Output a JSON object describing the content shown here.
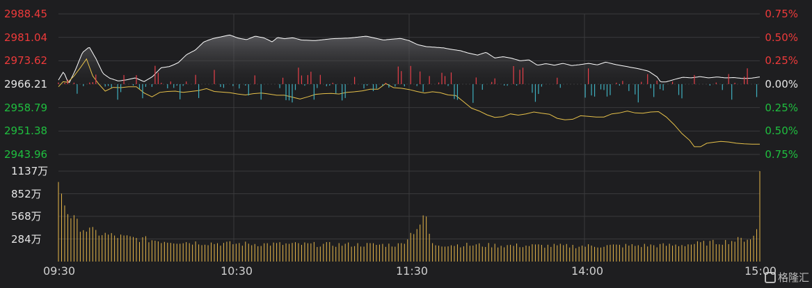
{
  "chart_data": {
    "type": "line",
    "subtype": "intraday-timeshare",
    "price_axis": {
      "ticks": [
        "2988.45",
        "2981.04",
        "2973.62",
        "2966.21",
        "2958.79",
        "2951.38",
        "2943.96"
      ],
      "ylim": [
        2943.96,
        2988.45
      ],
      "prev_close": 2966.21
    },
    "pct_axis": {
      "ticks": [
        "0.75%",
        "0.50%",
        "0.25%",
        "0.00%",
        "0.25%",
        "0.50%",
        "0.75%"
      ]
    },
    "volume_axis": {
      "ticks": [
        "1137万",
        "852万",
        "568万",
        "284万"
      ],
      "ylim": [
        0,
        1137
      ]
    },
    "time_labels": [
      "09:30",
      "10:30",
      "11:30",
      "14:00",
      "15:00"
    ],
    "colors": {
      "background": "#1e1e20",
      "up": "#e8404a",
      "down": "#3fb0c0",
      "price_line": "#ffffff",
      "avg_line": "#e8c24a",
      "volume": "#e8b84a",
      "grid": "#3a3a3c",
      "axis_up_text": "#ee3a3a",
      "axis_down_text": "#1fbf3f",
      "axis_neutral_text": "#e6e6e6"
    },
    "series": [
      {
        "name": "price",
        "points": [
          [
            0,
            2967.5
          ],
          [
            3,
            2970.2
          ],
          [
            6,
            2966.3
          ],
          [
            10,
            2970.8
          ],
          [
            14,
            2976.2
          ],
          [
            18,
            2978.0
          ],
          [
            22,
            2974.2
          ],
          [
            26,
            2969.6
          ],
          [
            30,
            2968.1
          ],
          [
            35,
            2967.2
          ],
          [
            40,
            2967.6
          ],
          [
            45,
            2968.2
          ],
          [
            50,
            2967.0
          ],
          [
            55,
            2968.6
          ],
          [
            60,
            2971.4
          ],
          [
            65,
            2971.8
          ],
          [
            70,
            2973.0
          ],
          [
            75,
            2975.6
          ],
          [
            80,
            2977.0
          ],
          [
            85,
            2979.6
          ],
          [
            90,
            2980.6
          ],
          [
            95,
            2981.2
          ],
          [
            100,
            2981.8
          ],
          [
            105,
            2980.8
          ],
          [
            110,
            2980.3
          ],
          [
            115,
            2981.4
          ],
          [
            120,
            2980.9
          ],
          [
            125,
            2979.6
          ],
          [
            128,
            2981.0
          ],
          [
            132,
            2980.6
          ],
          [
            137,
            2980.9
          ],
          [
            142,
            2980.2
          ],
          [
            150,
            2980.0
          ],
          [
            160,
            2980.6
          ],
          [
            170,
            2980.8
          ],
          [
            180,
            2981.4
          ],
          [
            190,
            2980.2
          ],
          [
            200,
            2980.7
          ],
          [
            205,
            2980.0
          ],
          [
            210,
            2978.7
          ],
          [
            215,
            2978.1
          ],
          [
            225,
            2977.7
          ],
          [
            230,
            2977.2
          ],
          [
            235,
            2976.8
          ],
          [
            240,
            2976.0
          ],
          [
            245,
            2975.4
          ],
          [
            250,
            2976.3
          ],
          [
            255,
            2974.5
          ],
          [
            260,
            2974.9
          ],
          [
            265,
            2974.4
          ],
          [
            270,
            2973.6
          ],
          [
            275,
            2973.9
          ],
          [
            280,
            2972.2
          ],
          [
            285,
            2972.7
          ],
          [
            290,
            2972.2
          ],
          [
            295,
            2972.8
          ],
          [
            300,
            2972.1
          ],
          [
            305,
            2972.4
          ],
          [
            310,
            2972.8
          ],
          [
            315,
            2972.3
          ],
          [
            320,
            2973.2
          ],
          [
            325,
            2972.5
          ],
          [
            330,
            2972.0
          ],
          [
            335,
            2971.5
          ],
          [
            340,
            2971.0
          ],
          [
            345,
            2970.3
          ],
          [
            350,
            2968.5
          ],
          [
            352,
            2966.9
          ],
          [
            355,
            2966.9
          ],
          [
            360,
            2967.7
          ],
          [
            365,
            2968.4
          ],
          [
            370,
            2968.2
          ],
          [
            375,
            2968.6
          ],
          [
            380,
            2968.2
          ],
          [
            385,
            2968.5
          ],
          [
            390,
            2968.2
          ],
          [
            395,
            2968.3
          ],
          [
            400,
            2968.0
          ],
          [
            405,
            2968.1
          ],
          [
            410,
            2968.5
          ]
        ]
      },
      {
        "name": "average",
        "points": [
          [
            0,
            2965.4
          ],
          [
            3,
            2967.0
          ],
          [
            6,
            2966.8
          ],
          [
            10,
            2968.8
          ],
          [
            14,
            2971.4
          ],
          [
            18,
            2974.2
          ],
          [
            22,
            2968.8
          ],
          [
            26,
            2966.2
          ],
          [
            30,
            2964.0
          ],
          [
            35,
            2965.2
          ],
          [
            40,
            2965.1
          ],
          [
            45,
            2965.4
          ],
          [
            50,
            2965.4
          ],
          [
            55,
            2963.4
          ],
          [
            60,
            2962.2
          ],
          [
            65,
            2963.6
          ],
          [
            70,
            2963.9
          ],
          [
            75,
            2964.0
          ],
          [
            80,
            2963.6
          ],
          [
            85,
            2963.9
          ],
          [
            90,
            2964.2
          ],
          [
            95,
            2964.8
          ],
          [
            100,
            2963.9
          ],
          [
            105,
            2963.7
          ],
          [
            110,
            2963.5
          ],
          [
            115,
            2963.1
          ],
          [
            120,
            2962.8
          ],
          [
            125,
            2963.2
          ],
          [
            130,
            2963.4
          ],
          [
            135,
            2963.1
          ],
          [
            140,
            2962.7
          ],
          [
            145,
            2962.7
          ],
          [
            150,
            2962.1
          ],
          [
            155,
            2961.5
          ],
          [
            160,
            2962.2
          ],
          [
            165,
            2963.0
          ],
          [
            170,
            2963.2
          ],
          [
            175,
            2963.3
          ],
          [
            180,
            2963.1
          ],
          [
            185,
            2963.6
          ],
          [
            190,
            2963.8
          ],
          [
            195,
            2964.1
          ],
          [
            200,
            2964.6
          ],
          [
            205,
            2964.6
          ],
          [
            210,
            2966.4
          ],
          [
            215,
            2965.1
          ],
          [
            220,
            2964.9
          ],
          [
            225,
            2964.5
          ],
          [
            230,
            2963.9
          ],
          [
            235,
            2963.4
          ],
          [
            240,
            2963.8
          ],
          [
            245,
            2963.5
          ],
          [
            250,
            2962.8
          ],
          [
            255,
            2962.6
          ],
          [
            260,
            2960.6
          ],
          [
            265,
            2958.6
          ],
          [
            270,
            2957.7
          ],
          [
            275,
            2956.5
          ],
          [
            280,
            2955.7
          ],
          [
            285,
            2955.9
          ],
          [
            290,
            2956.8
          ],
          [
            295,
            2956.4
          ],
          [
            300,
            2956.8
          ],
          [
            305,
            2957.4
          ],
          [
            310,
            2957.0
          ],
          [
            315,
            2956.7
          ],
          [
            320,
            2955.4
          ],
          [
            325,
            2954.9
          ],
          [
            330,
            2955.1
          ],
          [
            335,
            2956.2
          ],
          [
            340,
            2956.0
          ],
          [
            345,
            2955.8
          ],
          [
            350,
            2955.8
          ],
          [
            355,
            2956.8
          ],
          [
            360,
            2957.1
          ],
          [
            365,
            2957.7
          ],
          [
            370,
            2957.1
          ],
          [
            375,
            2957.0
          ],
          [
            380,
            2957.4
          ],
          [
            385,
            2957.5
          ],
          [
            390,
            2955.8
          ],
          [
            395,
            2953.4
          ],
          [
            400,
            2950.6
          ],
          [
            405,
            2948.4
          ],
          [
            408,
            2946.4
          ],
          [
            412,
            2946.4
          ],
          [
            416,
            2947.5
          ],
          [
            420,
            2947.8
          ],
          [
            425,
            2948.1
          ],
          [
            430,
            2947.9
          ],
          [
            435,
            2947.5
          ],
          [
            440,
            2947.3
          ],
          [
            445,
            2947.2
          ],
          [
            450,
            2947.2
          ]
        ]
      }
    ],
    "volume_profile": [
      [
        0,
        1000
      ],
      [
        3,
        760
      ],
      [
        6,
        620
      ],
      [
        9,
        520
      ],
      [
        12,
        450
      ],
      [
        16,
        400
      ],
      [
        20,
        380
      ],
      [
        25,
        350
      ],
      [
        30,
        330
      ],
      [
        40,
        300
      ],
      [
        50,
        280
      ],
      [
        60,
        260
      ],
      [
        80,
        240
      ],
      [
        100,
        225
      ],
      [
        150,
        215
      ],
      [
        200,
        210
      ],
      [
        215,
        560
      ],
      [
        218,
        215
      ],
      [
        250,
        205
      ],
      [
        300,
        195
      ],
      [
        330,
        200
      ],
      [
        360,
        205
      ],
      [
        370,
        220
      ],
      [
        390,
        250
      ],
      [
        400,
        280
      ],
      [
        405,
        300
      ],
      [
        408,
        330
      ],
      [
        410,
        1137
      ]
    ]
  }
}
